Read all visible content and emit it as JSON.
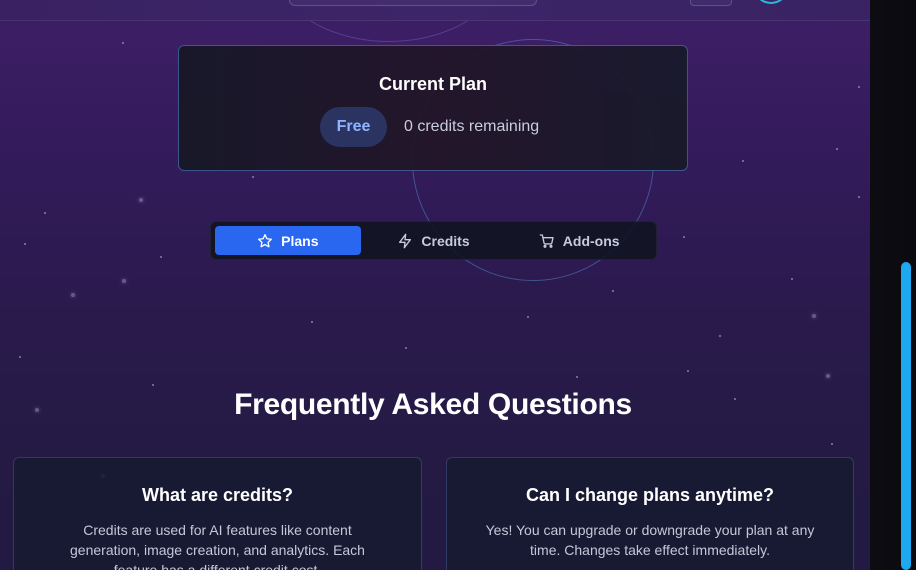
{
  "current_plan": {
    "title": "Current Plan",
    "plan_name": "Free",
    "credits_text": "0 credits remaining"
  },
  "tabs": [
    {
      "label": "Plans",
      "icon": "star-icon",
      "active": true
    },
    {
      "label": "Credits",
      "icon": "lightning-icon",
      "active": false
    },
    {
      "label": "Add-ons",
      "icon": "cart-icon",
      "active": false
    }
  ],
  "faq": {
    "heading": "Frequently Asked Questions",
    "items": [
      {
        "question": "What are credits?",
        "answer": "Credits are used for AI features like content generation, image creation, and analytics. Each feature has a different credit cost."
      },
      {
        "question": "Can I change plans anytime?",
        "answer": "Yes! You can upgrade or downgrade your plan at any time. Changes take effect immediately."
      }
    ]
  },
  "colors": {
    "accent": "#2a67f0",
    "badge_text": "#8fb4ff",
    "scroll_thumb": "#1ea8ef"
  }
}
